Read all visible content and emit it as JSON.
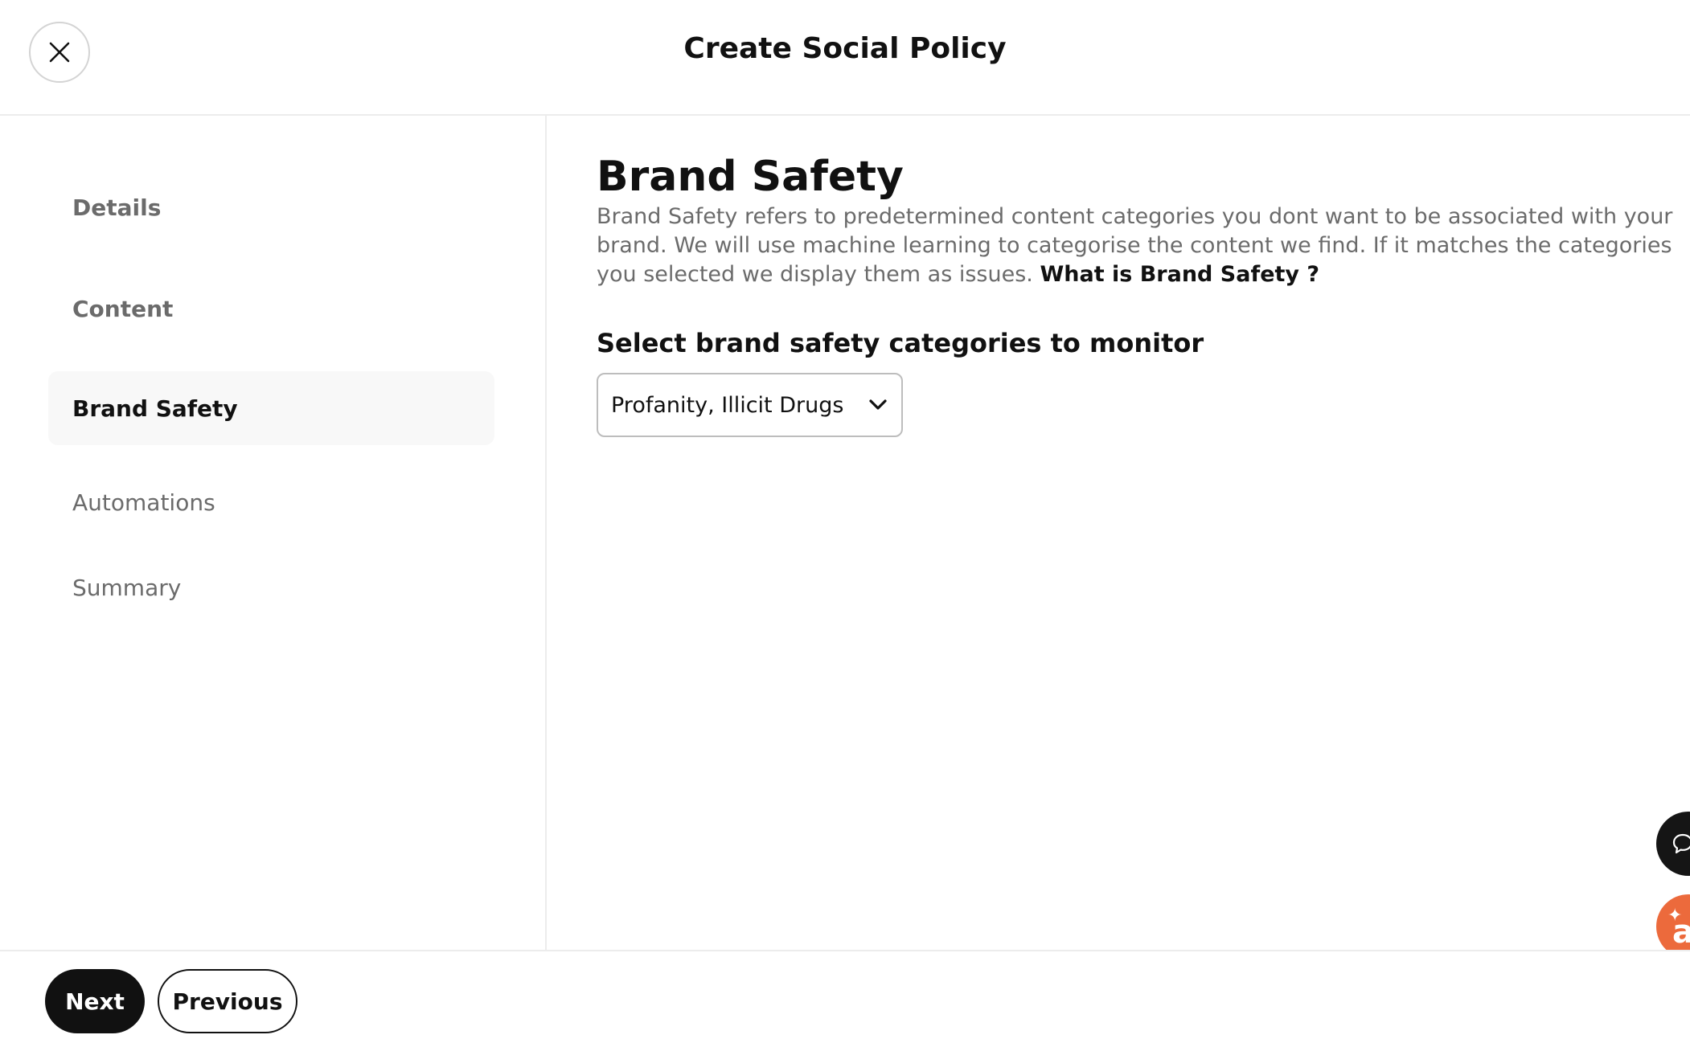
{
  "header": {
    "title": "Create Social Policy",
    "close_icon": "close-icon"
  },
  "sidebar": {
    "items": [
      {
        "label": "Details"
      },
      {
        "label": "Content"
      },
      {
        "label": "Brand Safety",
        "active": true
      },
      {
        "label": "Automations"
      },
      {
        "label": "Summary"
      }
    ]
  },
  "main": {
    "title": "Brand Safety",
    "description": "Brand Safety refers to predetermined content categories you dont want to be associated with your brand. We will use machine learning to categorise the content we find. If it matches the categories you selected we display them as issues.",
    "help_link": "What is Brand Safety ?",
    "select_label": "Select brand safety categories to monitor",
    "select_value": "Profanity, Illicit Drugs"
  },
  "footer": {
    "next_label": "Next",
    "previous_label": "Previous"
  },
  "widgets": {
    "chat_icon": "chat-bubble-icon",
    "assistant_icon": "assistant-icon",
    "assistant_letter": "a",
    "accent_color": "#ec6a3c"
  }
}
